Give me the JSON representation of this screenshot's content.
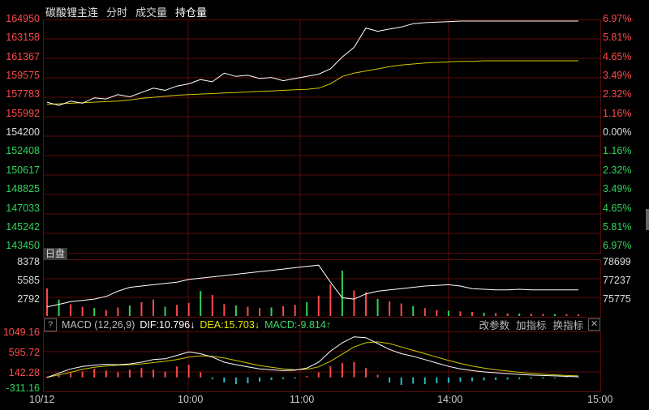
{
  "header": {
    "title": "碳酸锂主连",
    "tabs": [
      {
        "label": "分时",
        "active": false
      },
      {
        "label": "成交量",
        "active": false
      },
      {
        "label": "持仓量",
        "active": true
      }
    ]
  },
  "price_axis": {
    "labels": [
      "164950",
      "163158",
      "161367",
      "159575",
      "157783",
      "155992",
      "154200",
      "152408",
      "150617",
      "148825",
      "147033",
      "145242",
      "143450"
    ],
    "pct_labels": [
      "6.97%",
      "5.81%",
      "4.65%",
      "3.49%",
      "2.32%",
      "1.16%",
      "0.00%",
      "1.16%",
      "2.32%",
      "3.49%",
      "4.65%",
      "5.81%",
      "6.97%"
    ]
  },
  "day_badge": "日盘",
  "volume_axis": {
    "left": [
      "8378",
      "5585",
      "2792"
    ],
    "right": [
      "78699",
      "77237",
      "75775"
    ]
  },
  "macd_bar": {
    "help": "?",
    "label": "MACD (12,26,9)",
    "dif": "DIF:10.796↓",
    "dea": "DEA:15.703↓",
    "macd": "MACD:-9.814↑",
    "buttons": [
      "改参数",
      "加指标",
      "换指标"
    ],
    "close": "✕"
  },
  "macd_axis": [
    "1049.16",
    "595.72",
    "142.28",
    "-311.16"
  ],
  "time_axis": [
    "10/12",
    "10:00",
    "11:00",
    "14:00",
    "15:00"
  ],
  "colors": {
    "up": "#ff4a4a",
    "down": "#2fd35a",
    "price": "#ffffff",
    "avg": "#d4c800",
    "grid": "#5a0d0d"
  },
  "chart_data": [
    {
      "type": "line",
      "title": "",
      "x": [
        0,
        5,
        10,
        15,
        20,
        25,
        30,
        35,
        40,
        45,
        50,
        55,
        60,
        65,
        70,
        75,
        80,
        85,
        90,
        95,
        100,
        105,
        110,
        115,
        120,
        125,
        130,
        135,
        140,
        145,
        150,
        155,
        160,
        165,
        170,
        175,
        180,
        185,
        190,
        195,
        200,
        205,
        210,
        215,
        220,
        225
      ],
      "series": [
        {
          "values": [
            157400,
            157100,
            157500,
            157300,
            157800,
            157700,
            158100,
            157900,
            158300,
            158700,
            158500,
            158900,
            159100,
            159500,
            159300,
            160100,
            159800,
            159900,
            159600,
            159700,
            159400,
            159600,
            159800,
            160000,
            160500,
            161600,
            162500,
            164300,
            164000,
            164200,
            164400,
            164700,
            164800,
            164850,
            164900,
            164950,
            164950,
            164950,
            164950,
            164950,
            164950,
            164950,
            164950,
            164950,
            164950,
            164950
          ]
        },
        {
          "values": [
            157200,
            157250,
            157300,
            157350,
            157400,
            157450,
            157500,
            157600,
            157750,
            157850,
            157950,
            158050,
            158100,
            158150,
            158200,
            158250,
            158300,
            158350,
            158400,
            158450,
            158500,
            158550,
            158600,
            158700,
            159100,
            159800,
            160100,
            160300,
            160500,
            160700,
            160850,
            160950,
            161050,
            161100,
            161150,
            161200,
            161200,
            161250,
            161250,
            161250,
            161250,
            161250,
            161250,
            161250,
            161250,
            161250
          ]
        }
      ],
      "ylim": [
        143450,
        164950
      ]
    },
    {
      "type": "bar",
      "title": "",
      "x": [
        0,
        5,
        10,
        15,
        20,
        25,
        30,
        35,
        40,
        45,
        50,
        55,
        60,
        65,
        70,
        75,
        80,
        85,
        90,
        95,
        100,
        105,
        110,
        115,
        120,
        125,
        130,
        135,
        140,
        145,
        150,
        155,
        160,
        165,
        170,
        175,
        180,
        185,
        190,
        195,
        200,
        205,
        210,
        215,
        220,
        225
      ],
      "values": [
        4200,
        2500,
        1800,
        1400,
        1200,
        900,
        1300,
        1600,
        2100,
        2500,
        1400,
        1700,
        2000,
        3800,
        3200,
        1800,
        1600,
        1400,
        1200,
        1300,
        1500,
        1700,
        2100,
        3100,
        4800,
        6900,
        3900,
        3600,
        2600,
        2200,
        1900,
        1500,
        1200,
        900,
        800,
        700,
        600,
        500,
        450,
        400,
        380,
        350,
        330,
        300,
        280,
        260
      ],
      "series": [
        {
          "values": [
            75500,
            75700,
            75900,
            76000,
            76100,
            76300,
            76700,
            77000,
            77100,
            77200,
            77300,
            77400,
            77600,
            77700,
            77800,
            77900,
            78000,
            78100,
            78200,
            78300,
            78400,
            78500,
            78600,
            78700,
            77400,
            76200,
            76100,
            76500,
            76700,
            76800,
            76900,
            77000,
            77100,
            77150,
            77200,
            77100,
            76900,
            76850,
            76800,
            76800,
            76850,
            76800,
            76800,
            76800,
            76800,
            76800
          ]
        }
      ],
      "ylim": [
        0,
        8378
      ]
    },
    {
      "type": "bar",
      "title": "MACD (12,26,9)",
      "x": [
        0,
        5,
        10,
        15,
        20,
        25,
        30,
        35,
        40,
        45,
        50,
        55,
        60,
        65,
        70,
        75,
        80,
        85,
        90,
        95,
        100,
        105,
        110,
        115,
        120,
        125,
        130,
        135,
        140,
        145,
        150,
        155,
        160,
        165,
        170,
        175,
        180,
        185,
        190,
        195,
        200,
        205,
        210,
        215,
        220,
        225
      ],
      "values": [
        20,
        60,
        100,
        140,
        200,
        160,
        120,
        180,
        220,
        180,
        140,
        260,
        300,
        120,
        -40,
        -120,
        -160,
        -140,
        -100,
        -60,
        -40,
        -30,
        30,
        120,
        260,
        340,
        360,
        220,
        60,
        -120,
        -180,
        -150,
        -160,
        -140,
        -130,
        -110,
        -90,
        -70,
        -60,
        -50,
        -40,
        -30,
        -25,
        -20,
        -15,
        -10
      ],
      "series": [
        {
          "name": "DIF",
          "values": [
            0,
            100,
            200,
            260,
            290,
            310,
            300,
            320,
            360,
            420,
            440,
            520,
            600,
            560,
            480,
            360,
            300,
            250,
            200,
            180,
            160,
            170,
            220,
            360,
            620,
            820,
            960,
            940,
            800,
            660,
            560,
            500,
            420,
            340,
            260,
            200,
            160,
            130,
            110,
            90,
            70,
            55,
            45,
            35,
            25,
            15
          ]
        },
        {
          "name": "DEA",
          "values": [
            0,
            60,
            120,
            190,
            240,
            270,
            290,
            300,
            320,
            350,
            380,
            420,
            480,
            510,
            500,
            460,
            400,
            340,
            280,
            240,
            200,
            180,
            190,
            250,
            380,
            550,
            720,
            820,
            840,
            800,
            720,
            640,
            560,
            480,
            400,
            330,
            270,
            220,
            180,
            150,
            120,
            95,
            75,
            60,
            45,
            35
          ]
        }
      ],
      "ylim": [
        -311.16,
        1049.16
      ]
    }
  ]
}
